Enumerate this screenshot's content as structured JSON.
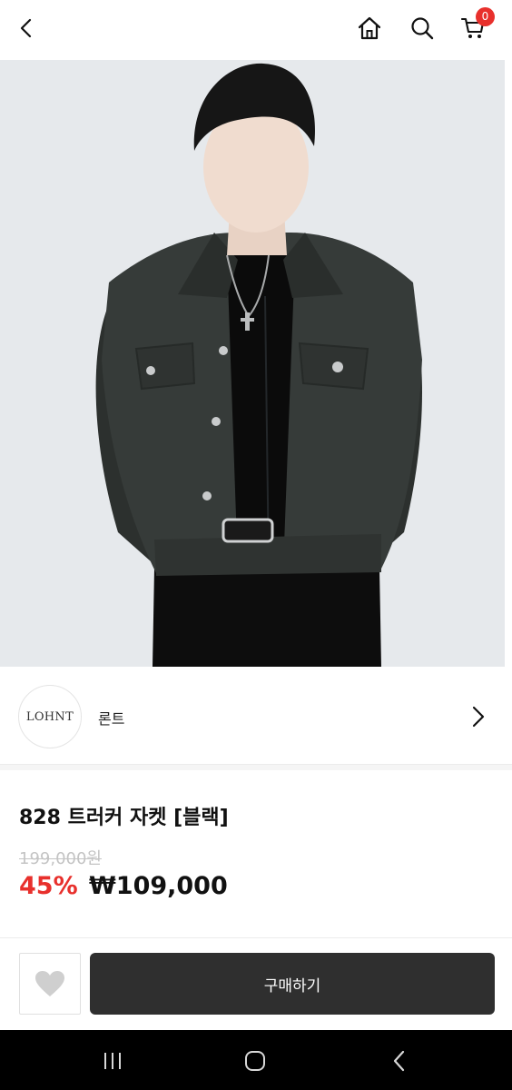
{
  "header": {
    "icons": {
      "back": "back-arrow-icon",
      "home": "home-icon",
      "search": "search-icon",
      "cart": "cart-icon"
    },
    "cart_count": "0"
  },
  "brand": {
    "logo_text": "LOHNT",
    "name": "론트"
  },
  "product": {
    "title": "828 트러커 자켓 [블랙]",
    "original_price": "199,000원",
    "discount_rate": "45%",
    "sale_price": "₩109,000"
  },
  "actions": {
    "buy_label": "구매하기"
  },
  "colors": {
    "accent_red": "#e8302c",
    "buy_button": "#2f2f2f"
  }
}
